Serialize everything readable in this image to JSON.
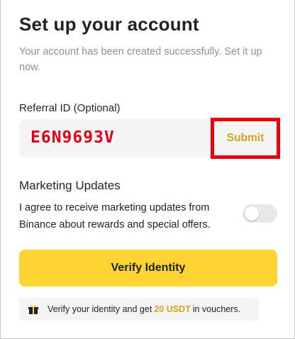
{
  "header": {
    "title": "Set up your account",
    "subtitle": "Your account has been created successfully. Set it up now."
  },
  "referral": {
    "label": "Referral ID (Optional)",
    "value": "E6N9693V",
    "submit_label": "Submit"
  },
  "marketing": {
    "title": "Marketing Updates",
    "description": "I agree to receive marketing updates from Binance about rewards and special offers.",
    "toggle_on": false
  },
  "verify": {
    "button_label": "Verify Identity"
  },
  "voucher": {
    "icon": "gift-icon",
    "text_before": "Verify your identity and get",
    "amount": "20 USDT",
    "text_after": "in vouchers."
  },
  "colors": {
    "brand_yellow": "#FCD535",
    "accent_gold": "#D9A21B",
    "highlight_red": "#E8000C",
    "text_primary": "#1E2329",
    "text_secondary": "#8A919C"
  }
}
